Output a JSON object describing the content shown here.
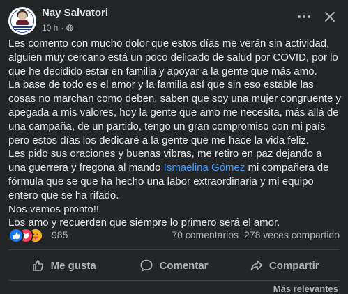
{
  "post": {
    "author": "Nay Salvatori",
    "time": "10 h",
    "separator": "·",
    "paragraphs": [
      "Les comento con mucho dolor que estos días me verán sin actividad, alguien muy cercano está un poco delicado de salud por COVID, por lo que he decidido estar en familia y apoyar a la gente que más amo.",
      "La base de todo es el amor y la familia así que sin eso estable las cosas no marchan como deben, saben que soy una mujer congruente y apegada a mis valores, hoy la gente que amo me necesita, más allá de una campaña, de un partido, tengo un gran compromiso con mi país pero estos días los dedicaré a la gente que me hace la vida feliz."
    ],
    "para3_before": "Les pido sus oraciones y buenas vibras, me retiro en paz dejando a una guerrera y fregona al mando ",
    "mention": "Ismaelina Gómez",
    "para3_after": " mi compañera de fórmula que se que ha hecho una labor extraordinaria y mi equipo entero que se ha rifado.",
    "para4": "Nos vemos pronto!!",
    "para5": "Los amo y recuerden que siempre lo primero será el amor."
  },
  "reactions": {
    "count": "985",
    "comments": "70 comentarios",
    "shares": "278 veces compartido",
    "icons": [
      "like-icon",
      "love-icon",
      "care-icon"
    ],
    "colors": {
      "like": "#1877f2",
      "love": "#f33e58",
      "care": "#f7b125"
    }
  },
  "actions": {
    "like": "Me gusta",
    "comment": "Comentar",
    "share": "Compartir"
  },
  "footer": {
    "sort": "Más relevantes"
  },
  "colors": {
    "background": "#242526",
    "text": "#e4e6eb",
    "secondary_text": "#b0b3b8",
    "link": "#4599ff"
  }
}
